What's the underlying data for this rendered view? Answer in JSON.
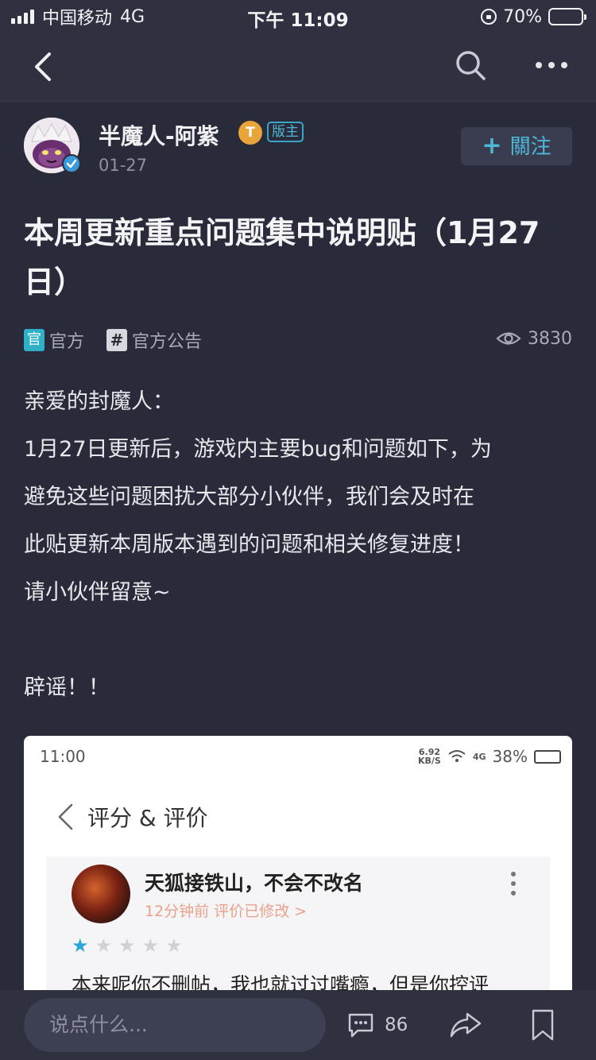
{
  "status_bar": {
    "carrier": "中国移动",
    "network": "4G",
    "time": "下午 11:09",
    "battery": "70%",
    "battery_level": 0.7
  },
  "nav": {
    "back_icon": "chevron-left-icon",
    "search_icon": "search-icon",
    "more_icon": "more-horizontal-icon"
  },
  "author": {
    "name": "半魔人-阿紫",
    "level_badge": "T",
    "role_badge": "版主",
    "date": "01-27",
    "follow_plus": "+",
    "follow_label": "關注"
  },
  "post": {
    "title": "本周更新重点问题集中说明贴（1月27日）",
    "tags": {
      "official_icon": "官",
      "official_label": "官方",
      "announce_icon": "#",
      "announce_label": "官方公告"
    },
    "views": "3830",
    "body": {
      "line1": "亲爱的封魔人：",
      "line2": "1月27日更新后，游戏内主要bug和问题如下，为",
      "line3": "避免这些问题困扰大部分小伙伴，我们会及时在",
      "line4": "此贴更新本周版本遇到的问题和相关修复进度！",
      "line5": "请小伙伴留意~",
      "line6": "辟谣！！"
    }
  },
  "embed": {
    "time": "11:00",
    "speed_top": "6.92",
    "speed_unit": "KB/S",
    "network": "4G",
    "battery": "38%",
    "battery_level": 0.38,
    "nav_title": "评分 & 评价",
    "reviewer": "天狐接铁山，不会不改名",
    "meta": "12分钟前 评价已修改 >",
    "stars_on": 1,
    "stars_total": 5,
    "text": "本来呢你不删帖，我也就过过嘴瘾，但是你控评"
  },
  "bottom": {
    "input_placeholder": "说点什么...",
    "comment_count": "86",
    "comment_icon": "comment-icon",
    "share_icon": "share-icon",
    "bookmark_icon": "bookmark-icon"
  },
  "colors": {
    "background": "#2a2b3a",
    "bar": "#2f3141",
    "accent": "#4fb8d8",
    "level_badge": "#e9a43a"
  }
}
